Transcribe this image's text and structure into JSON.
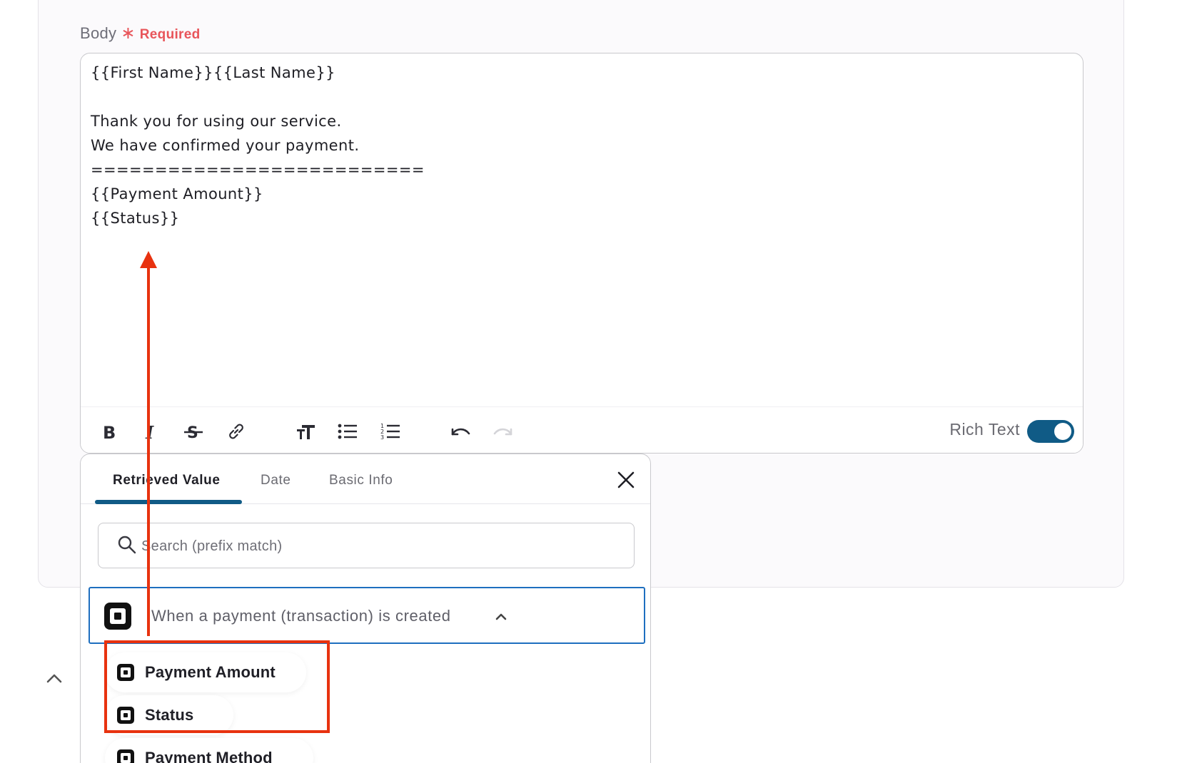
{
  "field": {
    "label": "Body",
    "asterisk": "∗",
    "required": "Required"
  },
  "editor": {
    "lines": [
      "{{First Name}}{{Last Name}}",
      "",
      "Thank you for using our service.",
      "We have confirmed your payment.",
      "==========================",
      "{{Payment Amount}}",
      "{{Status}}"
    ],
    "toolbar": {
      "rich_text_label": "Rich Text",
      "rich_text_enabled": true
    }
  },
  "panel": {
    "tabs": [
      {
        "label": "Retrieved Value",
        "active": true
      },
      {
        "label": "Date",
        "active": false
      },
      {
        "label": "Basic Info",
        "active": false
      }
    ],
    "search": {
      "placeholder": "Search (prefix match)",
      "value": ""
    },
    "trigger": {
      "label": "When a payment (transaction) is created",
      "expanded": true
    },
    "items": [
      {
        "label": "Payment Amount"
      },
      {
        "label": "Status"
      },
      {
        "label": "Payment Method"
      }
    ]
  },
  "colors": {
    "accent": "#105b86",
    "required": "#e8555a",
    "annotation": "#e8320f",
    "trigger_border": "#1e6fbf"
  }
}
